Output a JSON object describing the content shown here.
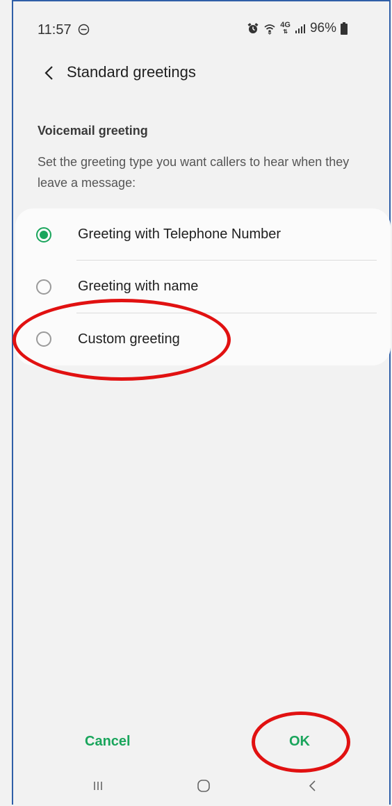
{
  "status_bar": {
    "time": "11:57",
    "battery": "96%"
  },
  "header": {
    "title": "Standard greetings"
  },
  "section": {
    "title": "Voicemail greeting",
    "description": "Set the greeting type you want callers to hear when they leave a message:"
  },
  "options": [
    {
      "label": "Greeting with Telephone Number",
      "selected": true
    },
    {
      "label": "Greeting with name",
      "selected": false
    },
    {
      "label": "Custom greeting",
      "selected": false
    }
  ],
  "buttons": {
    "cancel": "Cancel",
    "ok": "OK"
  },
  "colors": {
    "accent": "#1aa55c",
    "annotation": "#e11111",
    "background": "#f2f2f2"
  },
  "icons": {
    "status": [
      "do-not-disturb-icon",
      "alarm-icon",
      "wifi-icon",
      "4g-lte-icon",
      "signal-icon",
      "battery-icon"
    ],
    "nav": [
      "recent-apps-icon",
      "home-icon",
      "back-icon"
    ]
  }
}
